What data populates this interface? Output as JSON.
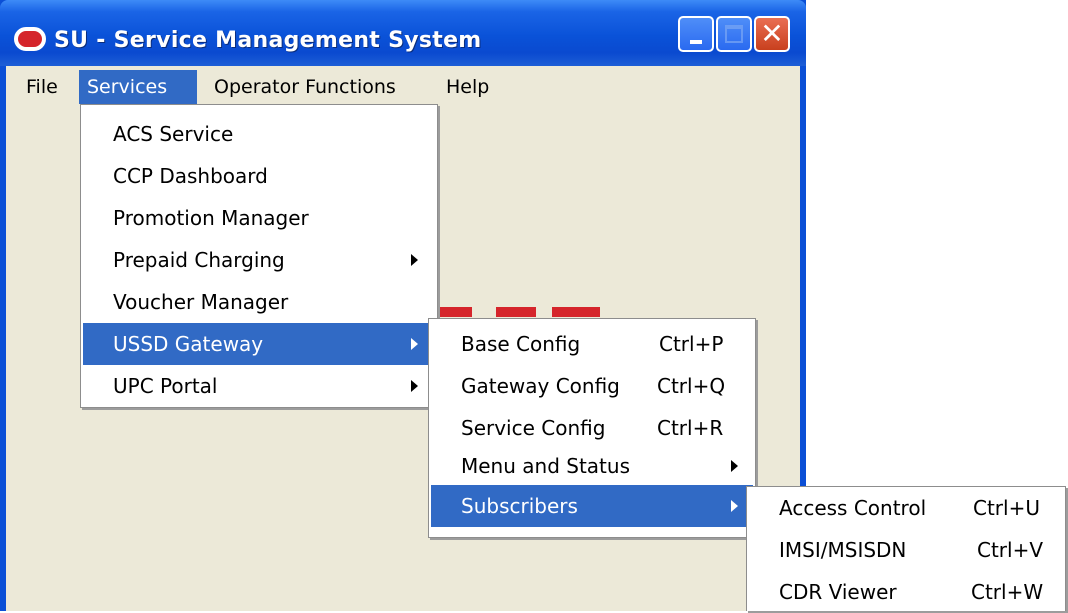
{
  "window": {
    "title": "SU - Service Management System"
  },
  "menubar": {
    "items": [
      "File",
      "Services",
      "Operator Functions",
      "Help"
    ]
  },
  "services_menu": {
    "items": [
      {
        "label": "ACS Service"
      },
      {
        "label": "CCP Dashboard"
      },
      {
        "label": "Promotion Manager"
      },
      {
        "label": "Prepaid Charging"
      },
      {
        "label": "Voucher Manager"
      },
      {
        "label": "USSD Gateway"
      },
      {
        "label": "UPC Portal"
      }
    ]
  },
  "ussd_menu": {
    "items": [
      {
        "label": "Base Config",
        "shortcut": "Ctrl+P"
      },
      {
        "label": "Gateway Config",
        "shortcut": "Ctrl+Q"
      },
      {
        "label": "Service Config",
        "shortcut": "Ctrl+R"
      },
      {
        "label": "Menu and Status",
        "shortcut": ""
      },
      {
        "label": "Subscribers",
        "shortcut": ""
      }
    ]
  },
  "subscribers_menu": {
    "items": [
      {
        "label": "Access Control",
        "shortcut": "Ctrl+U"
      },
      {
        "label": "IMSI/MSISDN",
        "shortcut": "Ctrl+V"
      },
      {
        "label": "CDR Viewer",
        "shortcut": "Ctrl+W"
      }
    ]
  },
  "colors": {
    "selection": "#316ac5",
    "titlebar": "#0a52d8",
    "client_bg": "#ece9d8",
    "brand_red": "#d5252b"
  },
  "icons": {
    "app": "oracle-logo-icon",
    "minimize": "minimize-icon",
    "maximize": "maximize-icon",
    "close": "close-icon",
    "submenu": "chevron-right-icon"
  }
}
